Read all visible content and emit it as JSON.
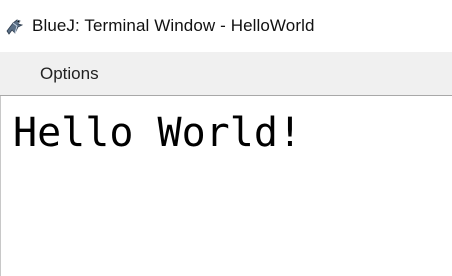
{
  "window": {
    "title": "BlueJ: Terminal Window - HelloWorld",
    "app_icon": "bluej-bird-icon"
  },
  "menubar": {
    "items": [
      {
        "label": "Options"
      }
    ]
  },
  "terminal": {
    "lines": [
      "Hello World!"
    ]
  }
}
